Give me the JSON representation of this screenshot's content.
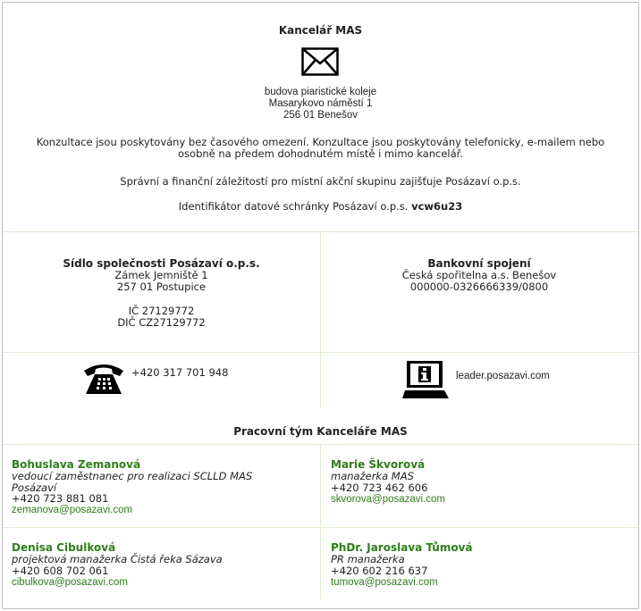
{
  "office": {
    "title": "Kancelář MAS",
    "address": [
      "budova piaristické koleje",
      "Masarykovo náměstí 1",
      "256 01 Benešov"
    ],
    "consult_line1": "Konzultace jsou poskytovány bez časového omezení. Konzultace jsou poskytovány telefonicky, e-mailem nebo",
    "consult_line2": "osobně na předem dohodnutém místě i mimo kancelář.",
    "admin_note": "Správní a finanční záležitostí pro místní akční skupinu zajišťuje Posázaví o.p.s.",
    "datovka_label": "Identifikátor datové schránky Posázaví o.p.s.",
    "datovka_id": "vcw6u23"
  },
  "seat": {
    "title": "Sídlo společnosti Posázaví o.p.s.",
    "street": "Zámek Jemniště 1",
    "city": "257 01  Postupice",
    "ic": "IČ 27129772",
    "dic": "DIČ CZ27129772"
  },
  "bank": {
    "title": "Bankovní spojení",
    "bank_name": "Česká spořitelna a.s. Benešov",
    "account": "000000-0326666339/0800"
  },
  "contact": {
    "phone": "+420 317 701 948",
    "web": "leader.posazavi.com",
    "phone_icon": "telephone-icon",
    "web_icon": "info-computer-icon",
    "mail_icon": "envelope-icon"
  },
  "team": {
    "title": "Pracovní tým Kanceláře MAS",
    "members": [
      {
        "name": "Bohuslava Zemanová",
        "role1": "vedoucí zaměstnanec pro realizaci SCLLD MAS",
        "role2": "Posázaví",
        "phone": "+420 723 881 081",
        "email": "zemanova@posazavi.com"
      },
      {
        "name": "Marie Škvorová",
        "role1": "manažerka MAS",
        "role2": "",
        "phone": "+420 723 462 606",
        "email": "skvorova@posazavi.com"
      },
      {
        "name": "Denisa Cibulková",
        "role1": "projektová manažerka Čistá řeka Sázava",
        "role2": "",
        "phone": "+420 608 702 061",
        "email": "cibulkova@posazavi.com"
      },
      {
        "name": "PhDr. Jaroslava Tůmová",
        "role1": "PR manažerka",
        "role2": "",
        "phone": "+420 602 216 637",
        "email": "tumova@posazavi.com"
      }
    ]
  },
  "colors": {
    "accent_green": "#2e7d1a",
    "divider": "#dcecd4",
    "border": "#bdbdbd"
  }
}
